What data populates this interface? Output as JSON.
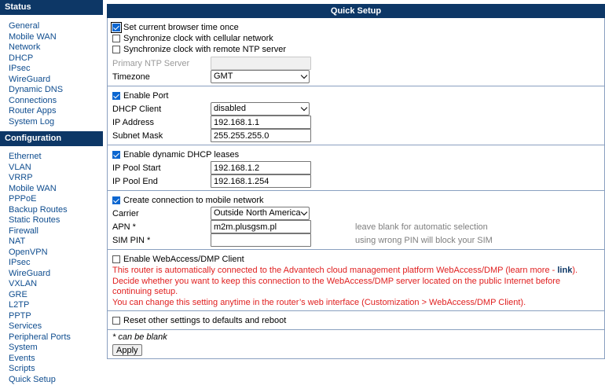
{
  "sidebar": {
    "status_title": "Status",
    "status_items": [
      "General",
      "Mobile WAN",
      "Network",
      "DHCP",
      "IPsec",
      "WireGuard",
      "Dynamic DNS",
      "Connections",
      "Router Apps",
      "System Log"
    ],
    "config_title": "Configuration",
    "config_items": [
      "Ethernet",
      "VLAN",
      "VRRP",
      "Mobile WAN",
      "PPPoE",
      "Backup Routes",
      "Static Routes",
      "Firewall",
      "NAT",
      "OpenVPN",
      "IPsec",
      "WireGuard",
      "VXLAN",
      "GRE",
      "L2TP",
      "PPTP",
      "Services",
      "Peripheral Ports",
      "System",
      "Events",
      "Scripts",
      "Quick Setup"
    ]
  },
  "main": {
    "title": "Quick Setup",
    "time": {
      "set_browser_time": "Set current browser time once",
      "sync_cellular": "Synchronize clock with cellular network",
      "sync_ntp": "Synchronize clock with remote NTP server",
      "ntp_label": "Primary NTP Server",
      "ntp_value": "",
      "timezone_label": "Timezone",
      "timezone_value": "GMT"
    },
    "port": {
      "enable_label": "Enable Port",
      "dhcp_client_label": "DHCP Client",
      "dhcp_client_value": "disabled",
      "ip_label": "IP Address",
      "ip_value": "192.168.1.1",
      "mask_label": "Subnet Mask",
      "mask_value": "255.255.255.0"
    },
    "dhcp": {
      "enable_label": "Enable dynamic DHCP leases",
      "start_label": "IP Pool Start",
      "start_value": "192.168.1.2",
      "end_label": "IP Pool End",
      "end_value": "192.168.1.254"
    },
    "mobile": {
      "enable_label": "Create connection to mobile network",
      "carrier_label": "Carrier",
      "carrier_value": "Outside North America",
      "apn_label": "APN *",
      "apn_value": "m2m.plusgsm.pl",
      "apn_hint": "leave blank for automatic selection",
      "pin_label": "SIM PIN *",
      "pin_value": "",
      "pin_hint": "using wrong PIN will block your SIM"
    },
    "wadmp": {
      "enable_label": "Enable WebAccess/DMP Client",
      "line1_pre": "This router is automatically connected to the Advantech cloud management platform WebAccess/DMP (learn more - ",
      "line1_link": "link",
      "line1_post": ").",
      "line2": "Decide whether you want to keep this connection to the WebAccess/DMP server located on the public Internet before continuing setup.",
      "line3": "You can change this setting anytime in the router’s web interface (Customization > WebAccess/DMP Client)."
    },
    "reset_label": "Reset other settings to defaults and reboot",
    "note": "* can be blank",
    "apply_label": "Apply"
  },
  "checkbox_states": {
    "set_browser_time": true,
    "sync_cellular": false,
    "sync_ntp": false,
    "enable_port": true,
    "enable_dhcp": true,
    "enable_mobile": true,
    "enable_wadmp": false,
    "reset": false
  },
  "colors": {
    "header_bg": "#0d3766",
    "link": "#0f4d8f",
    "warning": "#e02020",
    "hint": "#7f7f7f"
  }
}
